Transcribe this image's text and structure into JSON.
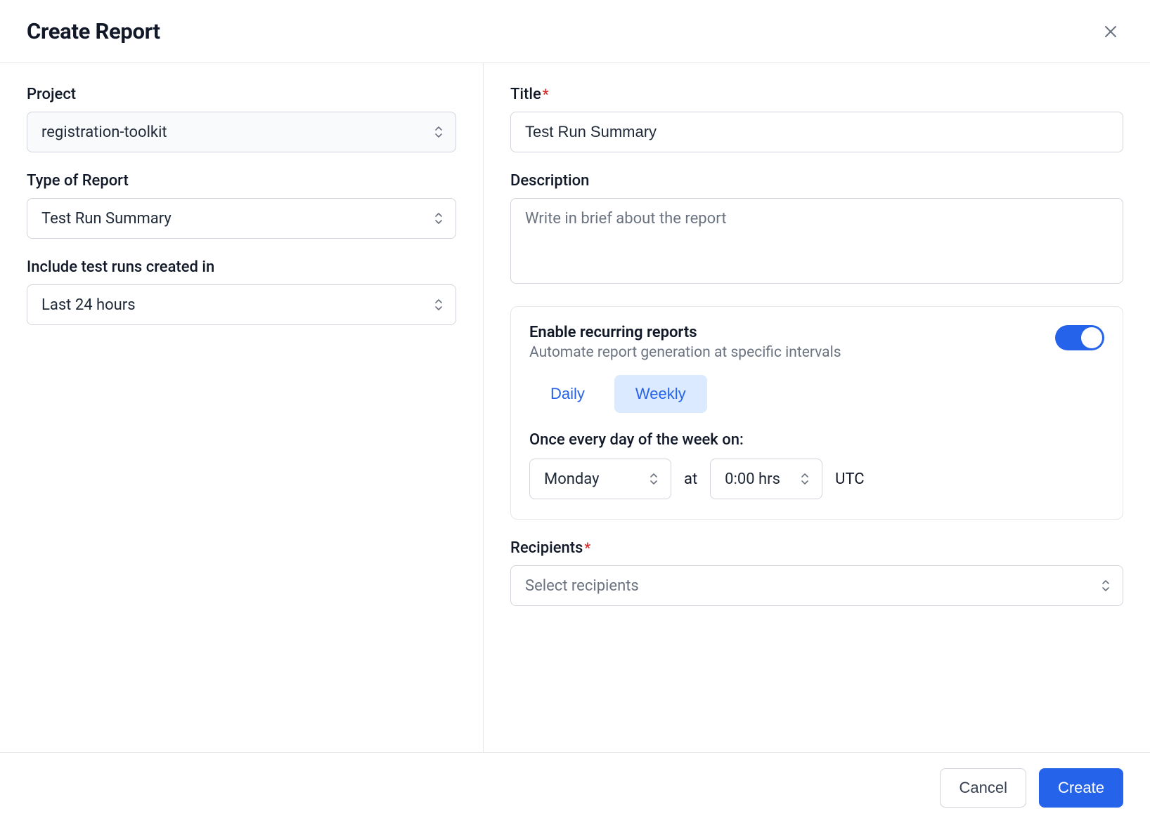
{
  "header": {
    "title": "Create Report"
  },
  "left": {
    "project": {
      "label": "Project",
      "value": "registration-toolkit"
    },
    "reportType": {
      "label": "Type of Report",
      "value": "Test Run Summary"
    },
    "include": {
      "label": "Include test runs created in",
      "value": "Last 24 hours"
    }
  },
  "right": {
    "title": {
      "label": "Title",
      "value": "Test Run Summary"
    },
    "description": {
      "label": "Description",
      "placeholder": "Write in brief about the report",
      "value": ""
    },
    "recurring": {
      "title": "Enable recurring reports",
      "subtitle": "Automate report generation at specific intervals",
      "enabled": true,
      "frequency": {
        "daily": "Daily",
        "weekly": "Weekly",
        "active": "weekly"
      },
      "schedule": {
        "label": "Once every day of the week on:",
        "day": "Monday",
        "at": "at",
        "time": "0:00 hrs",
        "tz": "UTC"
      }
    },
    "recipients": {
      "label": "Recipients",
      "placeholder": "Select recipients"
    }
  },
  "footer": {
    "cancel": "Cancel",
    "create": "Create"
  }
}
